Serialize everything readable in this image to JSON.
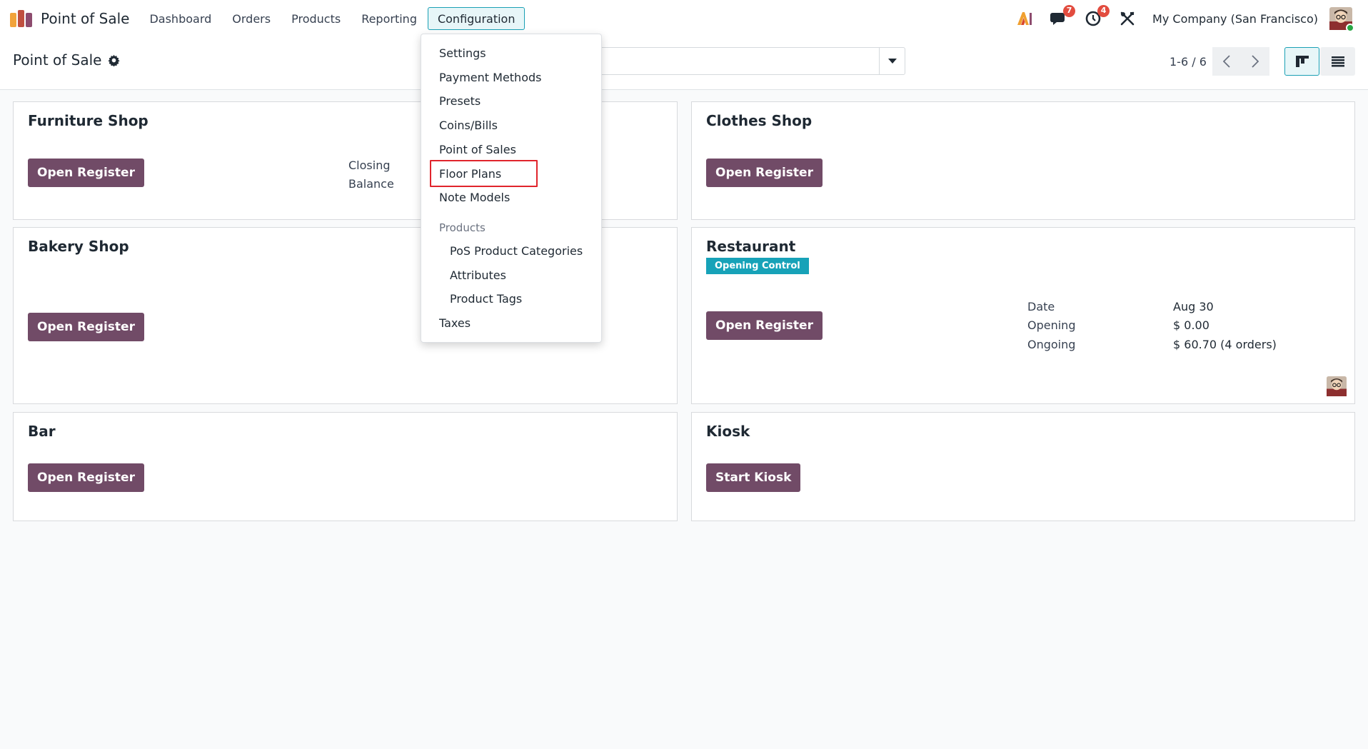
{
  "navbar": {
    "app_title": "Point of Sale",
    "menu": [
      "Dashboard",
      "Orders",
      "Products",
      "Reporting",
      "Configuration"
    ],
    "active_menu": "Configuration",
    "messages_count": "7",
    "activities_count": "4",
    "company": "My Company (San Francisco)",
    "brand_color": "#714b67",
    "accent_color": "#1aa0b5"
  },
  "control_panel": {
    "title": "Point of Sale",
    "pager": "1-6 / 6"
  },
  "config_menu": {
    "items": [
      "Settings",
      "Payment Methods",
      "Presets",
      "Coins/Bills",
      "Point of Sales",
      "Floor Plans",
      "Note Models"
    ],
    "products_header": "Products",
    "product_items": [
      "PoS Product Categories",
      "Attributes",
      "Product Tags"
    ],
    "taxes": "Taxes",
    "highlighted": "Floor Plans"
  },
  "cards": {
    "furniture": {
      "name": "Furniture Shop",
      "button": "Open Register",
      "closing_label": "Closing Balance"
    },
    "clothes": {
      "name": "Clothes Shop",
      "button": "Open Register"
    },
    "bakery": {
      "name": "Bakery Shop",
      "button": "Open Register"
    },
    "restaurant": {
      "name": "Restaurant",
      "tag": "Opening Control",
      "button": "Open Register",
      "stats": [
        {
          "label": "Date",
          "value": "Aug 30"
        },
        {
          "label": "Opening",
          "value": "$ 0.00"
        },
        {
          "label": "Ongoing",
          "value": "$ 60.70 (4 orders)"
        }
      ]
    },
    "bar": {
      "name": "Bar",
      "button": "Open Register"
    },
    "kiosk": {
      "name": "Kiosk",
      "button": "Start Kiosk"
    }
  }
}
